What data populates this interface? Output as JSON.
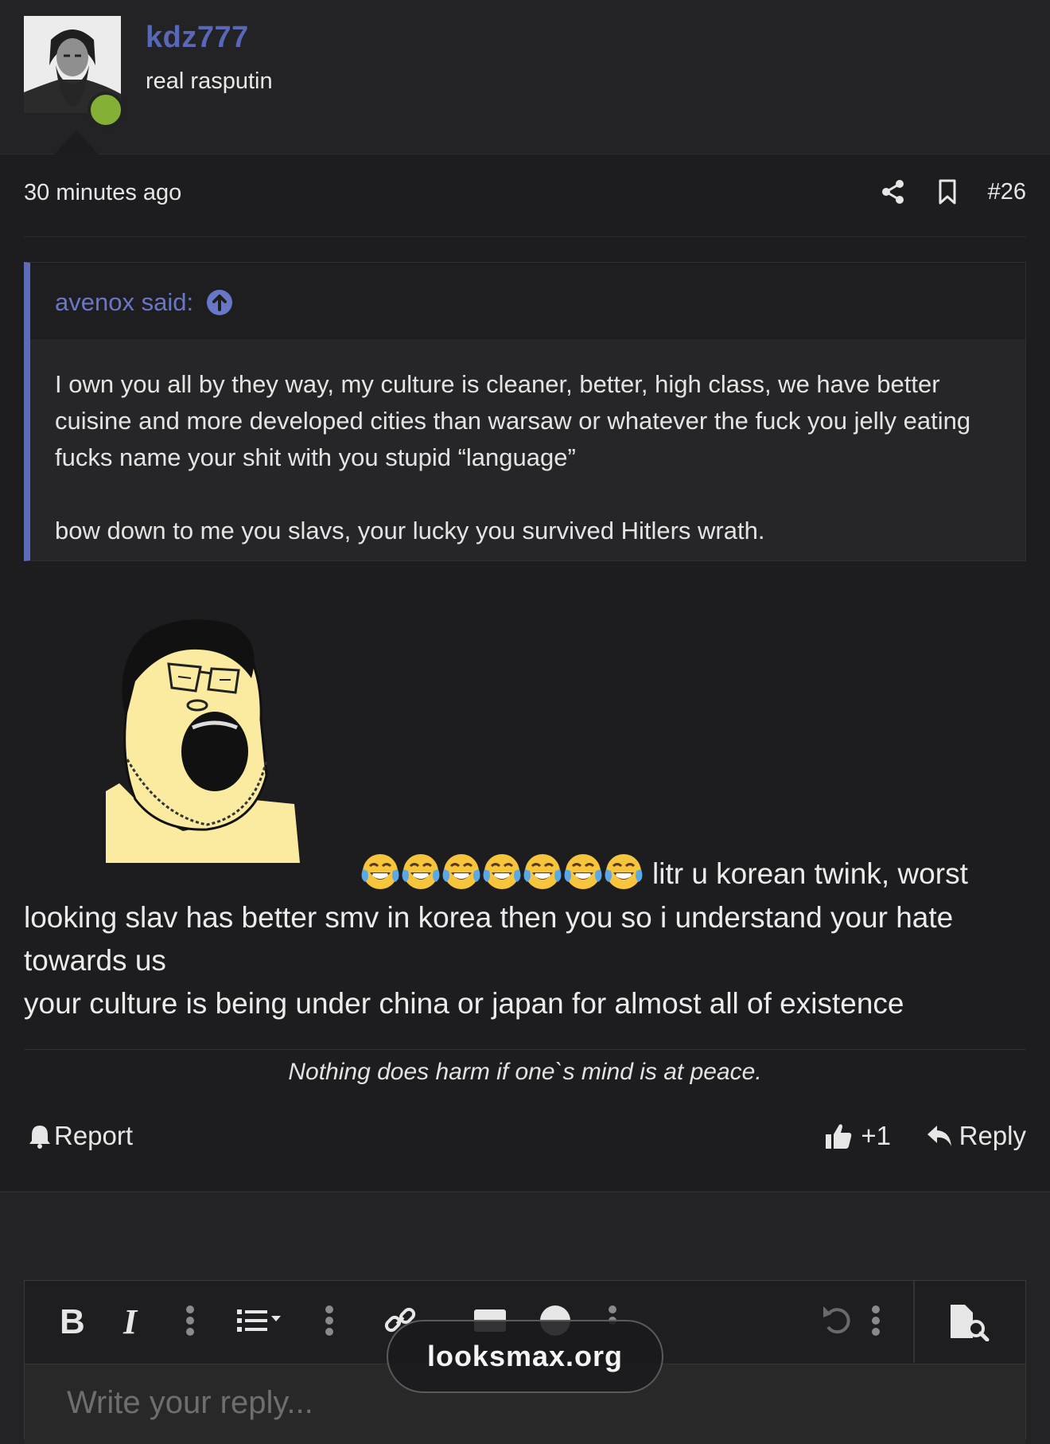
{
  "user": {
    "name": "kdz777",
    "title": "real rasputin",
    "online_color": "#84b135"
  },
  "post": {
    "time": "30 minutes ago",
    "number": "#26",
    "icons": [
      "share-icon",
      "bookmark-icon"
    ]
  },
  "quote": {
    "author": "avenox said:",
    "paragraph1": "I own you all by they way, my culture is cleaner, better, high class, we have better cuisine and more developed cities than warsaw or whatever the fuck you jelly eating fucks name your shit with you stupid “language”",
    "paragraph2": "bow down to me you slavs, your lucky you survived Hitlers wrath."
  },
  "message": {
    "emoji_count": 7,
    "line1": "litr u korean twink, worst",
    "line2": "looking slav has better smv in korea then you so i understand your hate",
    "line3": "towards us",
    "line4": "your culture is being under china or japan for almost all of existence"
  },
  "signature": "Nothing does harm if one`s mind is at peace.",
  "actions": {
    "report": "Report",
    "like_count": "+1",
    "reply": "Reply"
  },
  "editor": {
    "placeholder": "Write your reply..."
  },
  "watermark": "looksmax.org",
  "colors": {
    "accent": "#5d6bb8",
    "background": "#1d1d1f"
  }
}
